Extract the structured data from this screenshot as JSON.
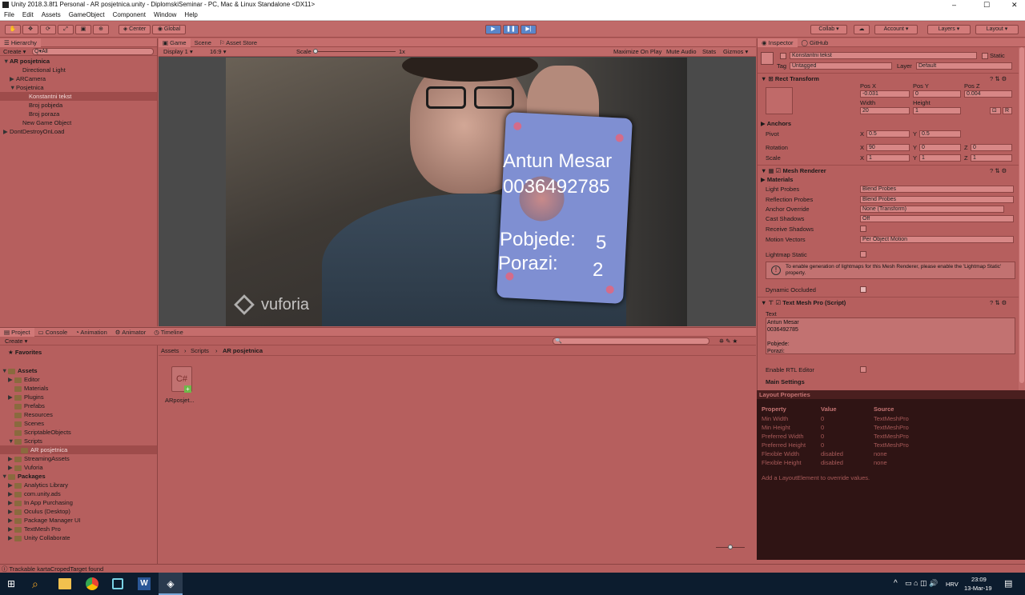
{
  "title": "Unity 2018.3.8f1 Personal - AR posjetnica.unity - DiplomskiSeminar - PC, Mac & Linux Standalone <DX11>",
  "window_controls": [
    "–",
    "☐",
    "✕"
  ],
  "menu": [
    "File",
    "Edit",
    "Assets",
    "GameObject",
    "Component",
    "Window",
    "Help"
  ],
  "toolbar": {
    "center": "Center",
    "global": "Global",
    "collab": "Collab ▾",
    "account": "Account",
    "layers": "Layers",
    "layout": "Layout"
  },
  "hierarchy": {
    "tab": "Hierarchy",
    "create": "Create ▾",
    "search": "Q▾All",
    "items": [
      {
        "label": "AR posjetnica",
        "bold": true,
        "indent": 0,
        "tri": "▼"
      },
      {
        "label": "Directional Light",
        "indent": 2,
        "tri": ""
      },
      {
        "label": "ARCamera",
        "indent": 1,
        "tri": "▶"
      },
      {
        "label": "Posjetnica",
        "indent": 1,
        "tri": "▼"
      },
      {
        "label": "Konstantni tekst",
        "indent": 3,
        "tri": "",
        "selected": true
      },
      {
        "label": "Broj pobjeda",
        "indent": 3,
        "tri": ""
      },
      {
        "label": "Broj poraza",
        "indent": 3,
        "tri": ""
      },
      {
        "label": "New Game Object",
        "indent": 2,
        "tri": ""
      },
      {
        "label": "DontDestroyOnLoad",
        "indent": 0,
        "tri": "▶"
      }
    ]
  },
  "game": {
    "tabs": [
      "Game",
      "Scene",
      "Asset Store"
    ],
    "display": "Display 1",
    "aspect": "16:9",
    "scale_label": "Scale",
    "scale_value": "1x",
    "options": [
      "Maximize On Play",
      "Mute Audio",
      "Stats",
      "Gizmos ▾"
    ],
    "card": {
      "name": "Antun Mesar",
      "number": "0036492785",
      "wins_label": "Pobjede:",
      "wins": "5",
      "losses_label": "Porazi:",
      "losses": "2"
    },
    "watermark": "vuforia"
  },
  "inspector": {
    "tabs": [
      "Inspector",
      "GitHub"
    ],
    "object_name": "Konstantni tekst",
    "static": "Static",
    "tag_label": "Tag",
    "tag": "Untagged",
    "layer_label": "Layer",
    "layer": "Default",
    "rect": {
      "title": "Rect Transform",
      "posx_label": "Pos X",
      "posy_label": "Pos Y",
      "posz_label": "Pos Z",
      "posx": "-0.031",
      "posy": "0",
      "posz": "0.004",
      "width_label": "Width",
      "height_label": "Height",
      "width": "20",
      "height": "1",
      "anchors": "Anchors",
      "pivot_label": "Pivot",
      "pivot_x": "0.5",
      "pivot_y": "0.5",
      "rotation_label": "Rotation",
      "rot_x": "90",
      "rot_y": "0",
      "rot_z": "0",
      "scale_label": "Scale",
      "scale_x": "1",
      "scale_y": "1",
      "scale_z": "1",
      "r": "R"
    },
    "mesh": {
      "title": "Mesh Renderer",
      "materials": "Materials",
      "light_probes_label": "Light Probes",
      "light_probes": "Blend Probes",
      "refl_label": "Reflection Probes",
      "refl": "Blend Probes",
      "anchor_label": "Anchor Override",
      "anchor": "None (Transform)",
      "cast_label": "Cast Shadows",
      "cast": "Off",
      "receive_label": "Receive Shadows",
      "motion_label": "Motion Vectors",
      "motion": "Per Object Motion",
      "lightmap_label": "Lightmap Static",
      "info": "To enable generation of lightmaps for this Mesh Renderer, please enable the 'Lightmap Static' property.",
      "occluded_label": "Dynamic Occluded"
    },
    "tmp": {
      "title": "Text Mesh Pro (Script)",
      "text_label": "Text",
      "text_lines": [
        "Antun Mesar",
        "0036492785",
        "",
        "Pobjede:",
        "Porazi:"
      ],
      "rtl_label": "Enable RTL Editor",
      "main_settings": "Main Settings"
    }
  },
  "layout_props": {
    "title": "Layout Properties",
    "headers": [
      "Property",
      "Value",
      "Source"
    ],
    "rows": [
      [
        "Min Width",
        "0",
        "TextMeshPro"
      ],
      [
        "Min Height",
        "0",
        "TextMeshPro"
      ],
      [
        "Preferred Width",
        "0",
        "TextMeshPro"
      ],
      [
        "Preferred Height",
        "0",
        "TextMeshPro"
      ],
      [
        "Flexible Width",
        "disabled",
        "none"
      ],
      [
        "Flexible Height",
        "disabled",
        "none"
      ]
    ],
    "note": "Add a LayoutElement to override values."
  },
  "project": {
    "tabs": [
      "Project",
      "Console",
      "Animation",
      "Animator",
      "Timeline"
    ],
    "create": "Create ▾",
    "favorites": "Favorites",
    "tree": [
      {
        "label": "Assets",
        "bold": true,
        "indent": 0,
        "tri": "▼"
      },
      {
        "label": "Editor",
        "indent": 1,
        "tri": "▶"
      },
      {
        "label": "Materials",
        "indent": 1,
        "tri": ""
      },
      {
        "label": "Plugins",
        "indent": 1,
        "tri": "▶"
      },
      {
        "label": "Prefabs",
        "indent": 1,
        "tri": ""
      },
      {
        "label": "Resources",
        "indent": 1,
        "tri": ""
      },
      {
        "label": "Scenes",
        "indent": 1,
        "tri": ""
      },
      {
        "label": "ScriptableObjects",
        "indent": 1,
        "tri": ""
      },
      {
        "label": "Scripts",
        "indent": 1,
        "tri": "▼"
      },
      {
        "label": "AR posjetnica",
        "indent": 2,
        "tri": "",
        "selected": true
      },
      {
        "label": "StreamingAssets",
        "indent": 1,
        "tri": "▶"
      },
      {
        "label": "Vuforia",
        "indent": 1,
        "tri": "▶"
      },
      {
        "label": "Packages",
        "bold": true,
        "indent": 0,
        "tri": "▼"
      },
      {
        "label": "Analytics Library",
        "indent": 1,
        "tri": "▶"
      },
      {
        "label": "com.unity.ads",
        "indent": 1,
        "tri": "▶"
      },
      {
        "label": "In App Purchasing",
        "indent": 1,
        "tri": "▶"
      },
      {
        "label": "Oculus (Desktop)",
        "indent": 1,
        "tri": "▶"
      },
      {
        "label": "Package Manager UI",
        "indent": 1,
        "tri": "▶"
      },
      {
        "label": "TextMesh Pro",
        "indent": 1,
        "tri": "▶"
      },
      {
        "label": "Unity Collaborate",
        "indent": 1,
        "tri": "▶"
      }
    ],
    "breadcrumb": [
      "Assets",
      "Scripts",
      "AR posjetnica"
    ],
    "asset_name": "ARposjet..."
  },
  "status": "Trackable kartaCropedTarget found",
  "taskbar": {
    "lang": "HRV",
    "time": "23:09",
    "date": "13-Mar-19"
  }
}
